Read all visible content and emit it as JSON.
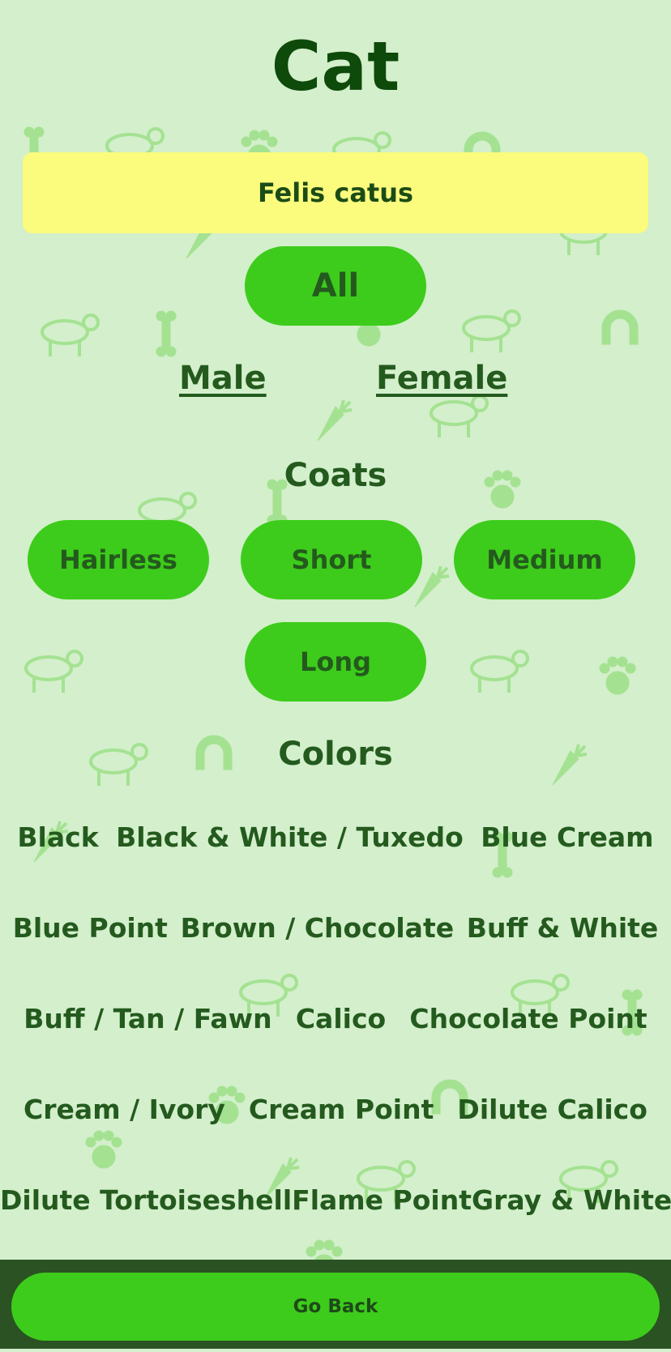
{
  "header": {
    "title": "Cat",
    "subtitle": "Felis catus"
  },
  "filters": {
    "all_label": "All",
    "male_label": "Male",
    "female_label": "Female"
  },
  "coats": {
    "title": "Coats",
    "items": [
      "Hairless",
      "Short",
      "Medium",
      "Long"
    ]
  },
  "colors": {
    "title": "Colors",
    "rows": [
      [
        "Black",
        "Black & White / Tuxedo",
        "Blue Cream"
      ],
      [
        "Blue Point",
        "Brown / Chocolate",
        "Buff & White"
      ],
      [
        "Buff / Tan / Fawn",
        "Calico",
        "Chocolate Point"
      ],
      [
        "Cream / Ivory",
        "Cream Point",
        "Dilute Calico"
      ],
      [
        "Dilute Tortoiseshell",
        "Flame Point",
        "Gray & White"
      ]
    ]
  },
  "footer": {
    "back_label": "Go Back"
  },
  "theme": {
    "background": "#d3efcb",
    "accent_green": "#3dcc1b",
    "highlight_yellow": "#fbfb7d",
    "footer_dark": "#2a5223",
    "text_dark_green": "#245a1e"
  },
  "background_icons": [
    "paw-icon",
    "bone-icon",
    "dog-icon",
    "cat-icon",
    "horse-icon",
    "rabbit-icon",
    "pig-icon",
    "carrot-icon",
    "horseshoe-icon",
    "lizard-icon"
  ]
}
